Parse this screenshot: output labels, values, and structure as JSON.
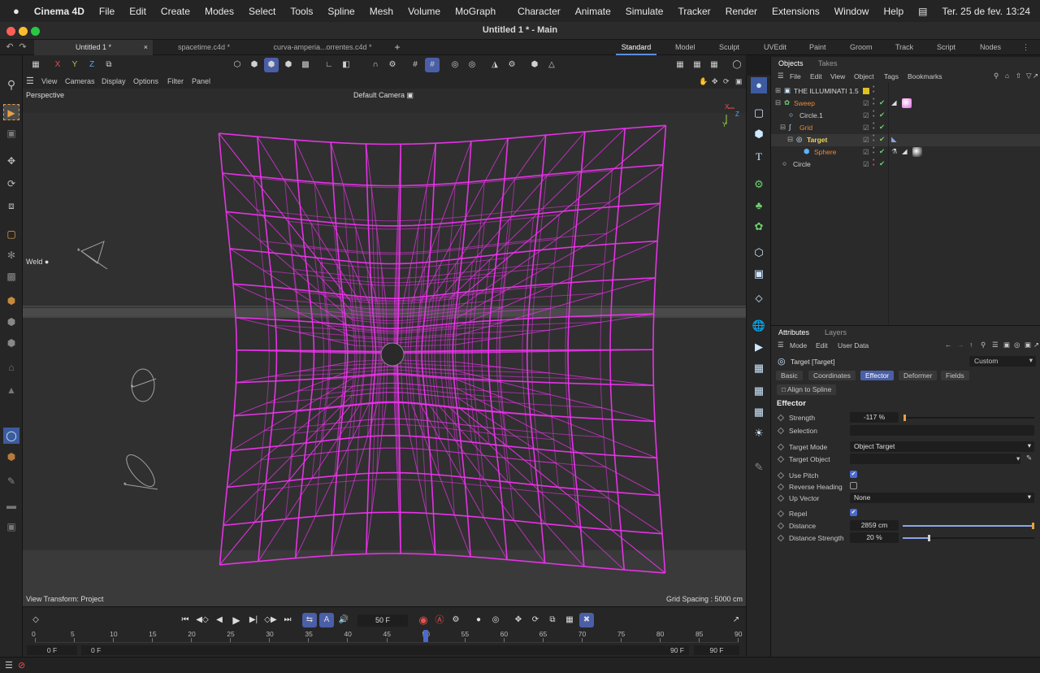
{
  "menubar": {
    "apple": "",
    "app": "Cinema 4D",
    "left": [
      "File",
      "Edit",
      "Create",
      "Modes",
      "Select",
      "Tools",
      "Spline",
      "Mesh",
      "Volume",
      "MoGraph"
    ],
    "right": [
      "Character",
      "Animate",
      "Simulate",
      "Tracker",
      "Render",
      "Extensions",
      "Window",
      "Help"
    ],
    "date": "Ter. 25 de fev.",
    "time": "13:24"
  },
  "window": {
    "title": "Untitled 1 * - Main"
  },
  "doc_tabs": [
    "Untitled 1 *",
    "spacetime.c4d *",
    "curva-amperia...orrentes.c4d *"
  ],
  "layouts": [
    "Standard",
    "Model",
    "Sculpt",
    "UVEdit",
    "Paint",
    "Groom",
    "Track",
    "Script",
    "Nodes"
  ],
  "toolbar": {
    "x": "X",
    "y": "Y",
    "z": "Z"
  },
  "viewport_menu": [
    "View",
    "Cameras",
    "Display",
    "Options",
    "Filter",
    "Panel"
  ],
  "viewport": {
    "name": "Perspective",
    "camera": "Default Camera",
    "weld": "Weld",
    "view_transform": "View Transform: Project",
    "grid_spacing": "Grid Spacing : 5000 cm",
    "wire_color": "#ee33ee"
  },
  "objects_panel": {
    "tabs": [
      "Objects",
      "Takes"
    ],
    "menu": [
      "File",
      "Edit",
      "View",
      "Object",
      "Tags",
      "Bookmarks"
    ],
    "items": [
      {
        "name": "THE ILLUMINATI 1.5",
        "color": "#d8d8d8"
      },
      {
        "name": "Sweep",
        "color": "#e9873a"
      },
      {
        "name": "Circle.1",
        "color": "#d0d0d0"
      },
      {
        "name": "Grid",
        "color": "#e9873a"
      },
      {
        "name": "Target",
        "color": "#f0d060"
      },
      {
        "name": "Sphere",
        "color": "#e9873a"
      },
      {
        "name": "Circle",
        "color": "#d0d0d0"
      }
    ]
  },
  "attributes_panel": {
    "tabs": [
      "Attributes",
      "Layers"
    ],
    "menu": [
      "Mode",
      "Edit",
      "User Data"
    ],
    "object": "Target [Target]",
    "preset": "Custom",
    "subtabs": [
      "Basic",
      "Coordinates",
      "Effector",
      "Deformer",
      "Fields"
    ],
    "align_button": "Align to Spline",
    "section": "Effector",
    "strength_label": "Strength",
    "strength_value": "-117 %",
    "selection_label": "Selection",
    "target_mode_label": "Target Mode",
    "target_mode_value": "Object Target",
    "target_object_label": "Target Object",
    "use_pitch_label": "Use Pitch",
    "reverse_heading_label": "Reverse Heading",
    "up_vector_label": "Up Vector",
    "up_vector_value": "None",
    "repel_label": "Repel",
    "distance_label": "Distance",
    "distance_value": "2859 cm",
    "distance_fraction": 1.0,
    "distance_strength_label": "Distance Strength",
    "distance_strength_value": "20 %",
    "distance_strength_fraction": 0.2
  },
  "timeline": {
    "frame": "50 F",
    "ticks": [
      "0",
      "5",
      "10",
      "15",
      "20",
      "25",
      "30",
      "35",
      "40",
      "45",
      "50",
      "55",
      "60",
      "65",
      "70",
      "75",
      "80",
      "85",
      "90"
    ],
    "start_a": "0 F",
    "start_b": "0 F",
    "end_a": "90 F",
    "end_b": "90 F",
    "current_fraction": 0.5556
  }
}
